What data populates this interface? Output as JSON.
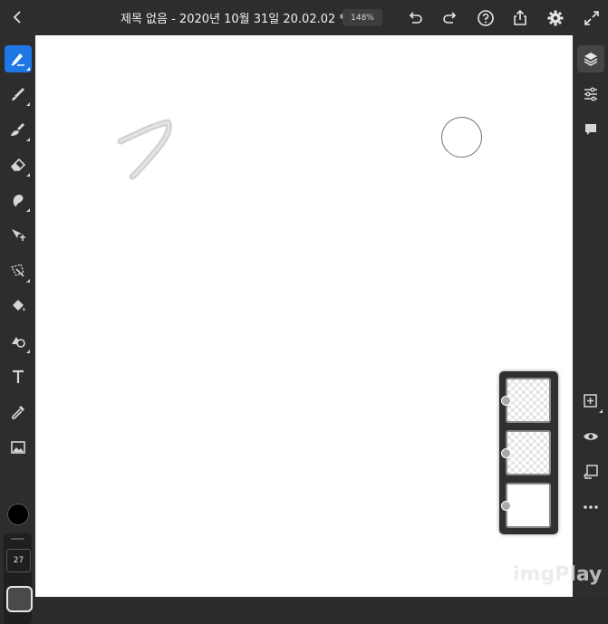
{
  "topbar": {
    "title": "제목 없음 - 2020년 10월 31일 20.02.02 *",
    "zoom": "148%",
    "icons": [
      "back-icon",
      "chevron-down-icon",
      "undo-icon",
      "redo-icon",
      "help-icon",
      "share-icon",
      "settings-icon",
      "fullscreen-icon"
    ]
  },
  "tools": {
    "items": [
      "pixel-brush",
      "live-brush",
      "vector-brush",
      "eraser",
      "smudge",
      "transform",
      "selection",
      "fill",
      "shape",
      "text",
      "eyedropper",
      "image"
    ],
    "active": "pixel-brush",
    "color": "#000000",
    "brush_size": "27"
  },
  "right_bar": {
    "top_icons": [
      "layers-icon",
      "layer-properties-icon",
      "comments-icon"
    ],
    "bottom_icons": [
      "add-layer-icon",
      "visibility-icon",
      "merge-down-icon",
      "more-icon"
    ]
  },
  "layers": {
    "count": 3
  },
  "watermark": "imgPlay",
  "colors": {
    "accent": "#1f77e6",
    "toolbar_bg": "#2d2d2d",
    "canvas_bg": "#ffffff"
  }
}
